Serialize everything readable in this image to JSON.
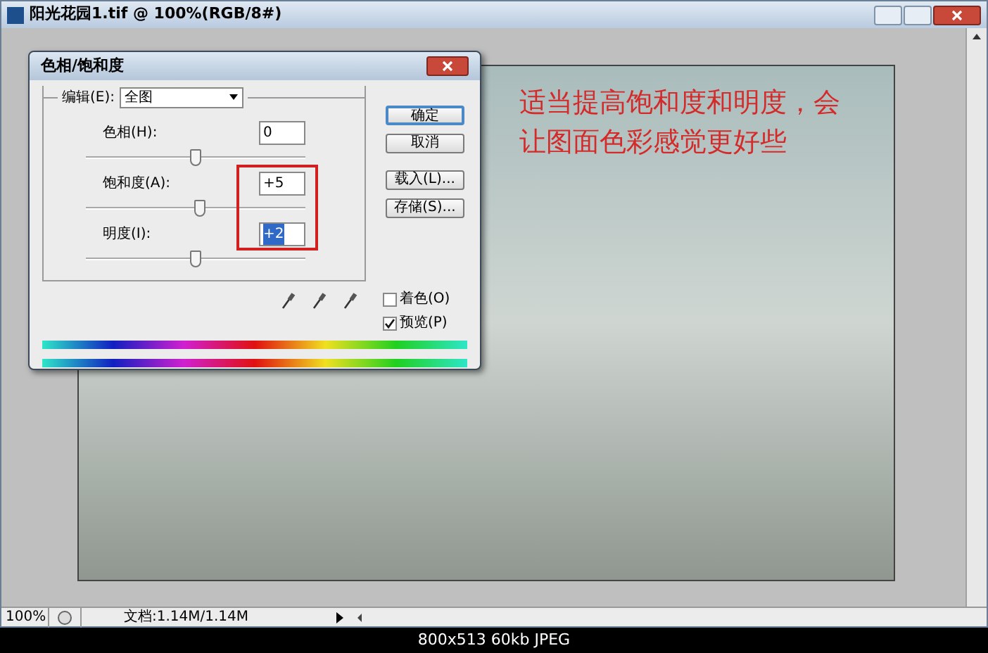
{
  "window": {
    "title": "阳光花园1.tif @ 100%(RGB/8#)"
  },
  "dialog": {
    "title": "色相/饱和度",
    "edit": {
      "label": "编辑(E):",
      "value": "全图"
    },
    "sliders": [
      {
        "label": "色相(H):",
        "value": "0",
        "level": 0.5,
        "value_selected": false
      },
      {
        "label": "饱和度(A):",
        "value": "+5",
        "level": 0.52,
        "value_selected": false
      },
      {
        "label": "明度(I):",
        "value": "+2",
        "level": 0.5,
        "value_selected": true
      }
    ],
    "buttons": [
      {
        "label": "确定",
        "default": true
      },
      {
        "label": "取消",
        "default": false
      },
      {
        "label": "载入(L)...",
        "default": false
      },
      {
        "label": "存储(S)...",
        "default": false
      }
    ],
    "checkboxes": [
      {
        "label": "着色(O)",
        "checked": false
      },
      {
        "label": "预览(P)",
        "checked": true
      }
    ]
  },
  "annotation": {
    "lines": [
      "适当提高饱和度和明度，会",
      "让图面色彩感觉更好些"
    ]
  },
  "status_bar": {
    "zoom": "100%",
    "document": "文档:1.14M/1.14M"
  },
  "image_info": "800x513 60kb JPEG"
}
